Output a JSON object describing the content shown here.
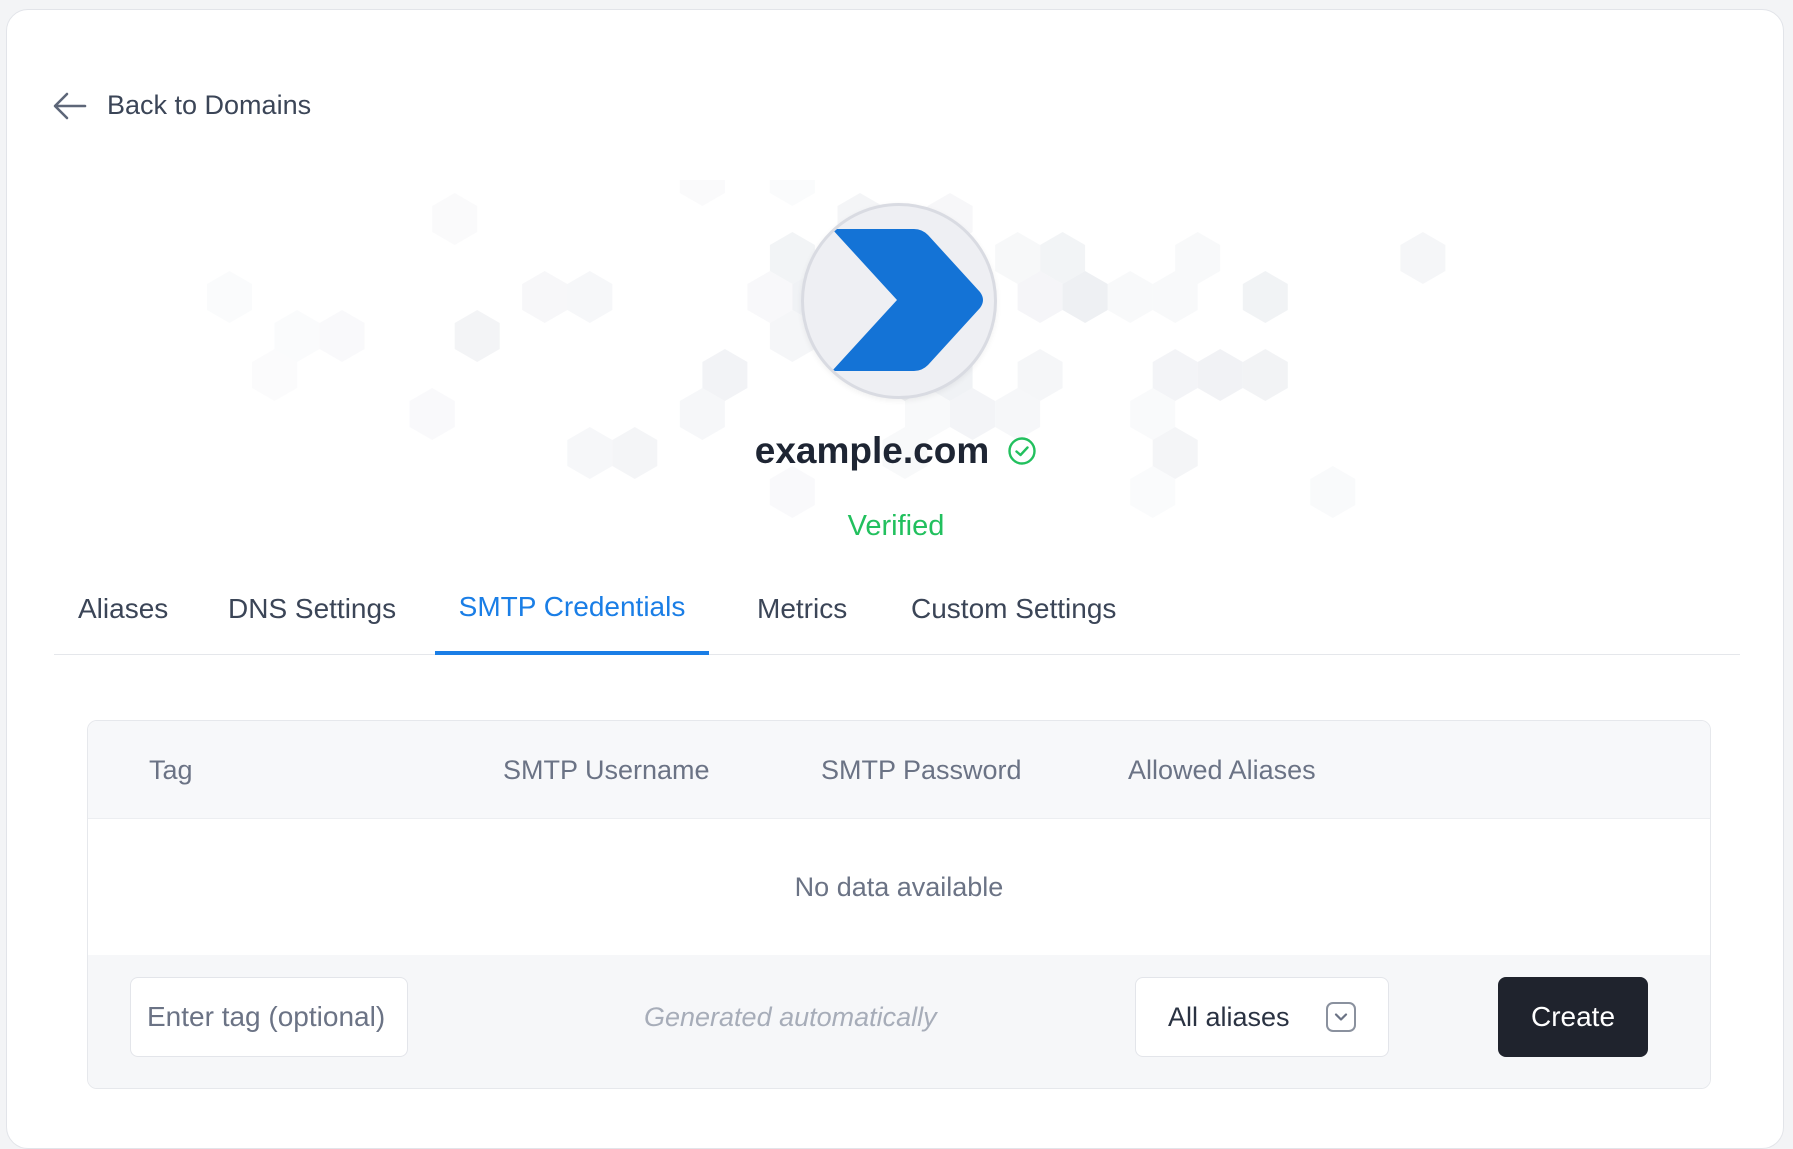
{
  "nav": {
    "back_label": "Back to Domains",
    "back_icon": "arrow-left-icon"
  },
  "domain": {
    "name": "example.com",
    "status": "Verified",
    "status_icon": "check-circle-icon",
    "logo_icon": "chevron-right-logo-icon"
  },
  "tabs": [
    {
      "label": "Aliases",
      "active": false
    },
    {
      "label": "DNS Settings",
      "active": false
    },
    {
      "label": "SMTP Credentials",
      "active": true
    },
    {
      "label": "Metrics",
      "active": false
    },
    {
      "label": "Custom Settings",
      "active": false
    }
  ],
  "table": {
    "columns": [
      "Tag",
      "SMTP Username",
      "SMTP Password",
      "Allowed Aliases"
    ],
    "empty_message": "No data available"
  },
  "form": {
    "tag_placeholder": "Enter tag (optional)",
    "tag_value": "",
    "username_hint": "Generated automatically",
    "aliases_selected": "All aliases",
    "create_label": "Create"
  },
  "colors": {
    "accent": "#1a7ee6",
    "verified": "#22c05e",
    "logo_blue": "#1473d6",
    "button_dark": "#1f232d"
  }
}
